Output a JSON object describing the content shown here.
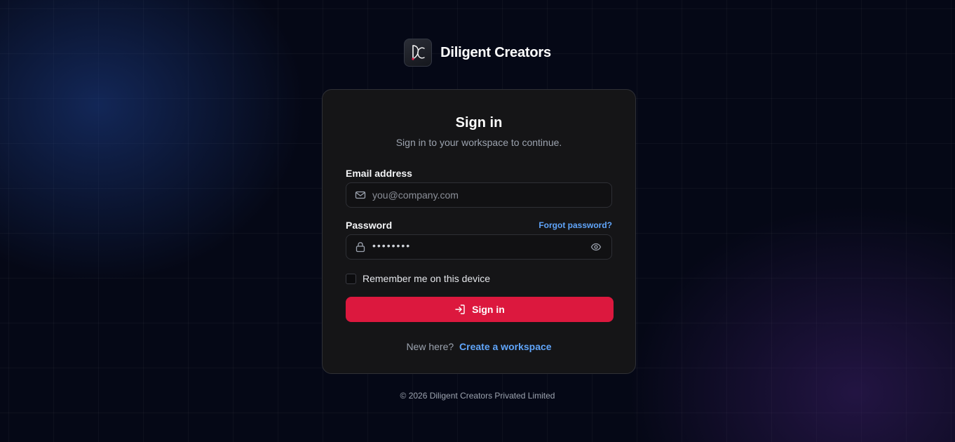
{
  "brand": {
    "name": "Diligent Creators",
    "logo_icon": "dc-monogram-logo"
  },
  "card": {
    "title": "Sign in",
    "subtitle": "Sign in to your workspace to continue.",
    "email": {
      "label": "Email address",
      "placeholder": "you@company.com",
      "value": "",
      "icon": "mail-icon"
    },
    "password": {
      "label": "Password",
      "forgot_label": "Forgot password?",
      "masked_value": "••••••••",
      "icon": "lock-icon",
      "toggle_icon": "eye-icon"
    },
    "remember": {
      "label": "Remember me on this device",
      "checked": false
    },
    "submit": {
      "label": "Sign in",
      "icon": "sign-in-icon",
      "color": "#dc183e"
    },
    "signup": {
      "prompt": "New here?",
      "link_label": "Create a workspace"
    }
  },
  "footer": {
    "copyright": "© 2026 Diligent Creators Privated Limited"
  },
  "colors": {
    "background": "#050816",
    "card": "#151517",
    "accent_link": "#60a5fa",
    "primary_button": "#dc183e"
  }
}
